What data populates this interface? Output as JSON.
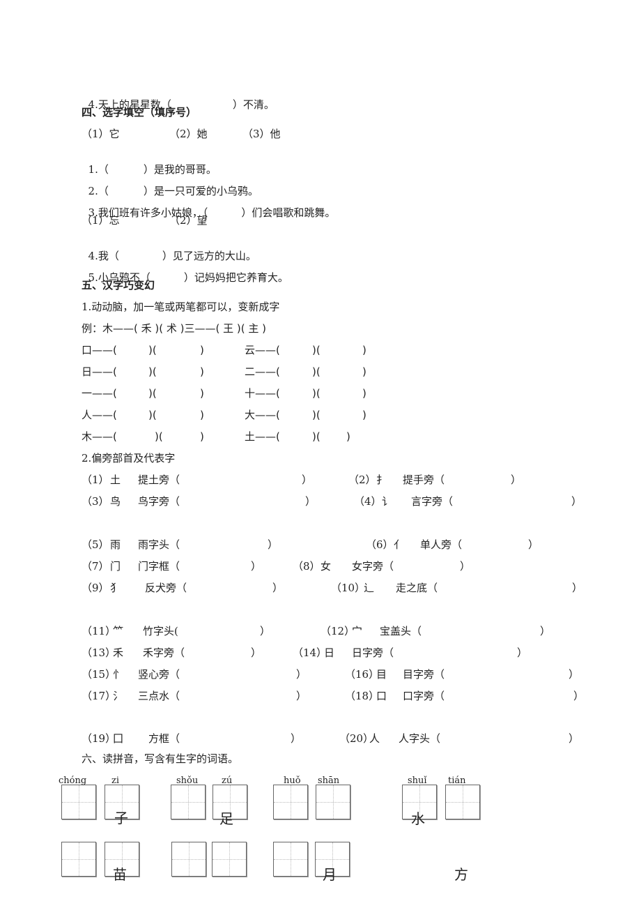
{
  "section3_tail": {
    "q4": {
      "pre": "4.天上的星星数（",
      "post": "）不清。"
    }
  },
  "section4": {
    "title": "四、选字填空（填序号）",
    "group1_options": [
      "（1）它",
      "（2）她",
      "（3）他"
    ],
    "q1": {
      "pre": "1.（",
      "post": "）是我的哥哥。"
    },
    "q2": {
      "pre": "2.（",
      "post": "）是一只可爱的小乌鸦。"
    },
    "q3": {
      "pre": "3.我们班有许多小姑娘，（",
      "post": "）们会唱歌和跳舞。"
    },
    "group2_options": [
      "（1）忘",
      "（2）望"
    ],
    "q4": {
      "pre": "4.我（",
      "post": "）见了远方的大山。"
    },
    "q5": {
      "pre": "5.小乌鸦不（",
      "post": "）记妈妈把它养育大。"
    }
  },
  "section5": {
    "title": "五、汉字巧变幻",
    "part1_title": "1.动动脑，加一笔或两笔都可以，变新成字",
    "example": "例：木——( 禾 )( 术 )三——( 王 )( 主 )",
    "rows": [
      {
        "left": "口——(",
        "right": "云——("
      },
      {
        "left": "日——(",
        "right": "二——("
      },
      {
        "left": "一——(",
        "right": "十——("
      },
      {
        "left": "人——(",
        "right": "大——("
      },
      {
        "left": "木——(",
        "right": "土——("
      }
    ],
    "paren_mid": ")(",
    "paren_close": ")",
    "part2_title": "2.偏旁部首及代表字",
    "radicals": [
      {
        "num": "（1）",
        "radical": "土",
        "name": "提土旁（"
      },
      {
        "num": "（2）",
        "radical": "扌",
        "name": "提手旁（"
      },
      {
        "num": "（3）",
        "radical": "鸟",
        "name": "鸟字旁（"
      },
      {
        "num": "（4）",
        "radical": "讠",
        "name": "言字旁（"
      },
      {
        "num": "（5）",
        "radical": "雨",
        "name": "雨字头（"
      },
      {
        "num": "（6）",
        "radical": "亻",
        "name": "单人旁（"
      },
      {
        "num": "（7）",
        "radical": "门",
        "name": "门字框（"
      },
      {
        "num": "（8）",
        "radical": "女",
        "name": "女字旁（"
      },
      {
        "num": "（9）",
        "radical": "犭",
        "name": "反犬旁（"
      },
      {
        "num": "（10）",
        "radical": "辶",
        "name": "走之底（"
      },
      {
        "num": "（11）",
        "radical": "⺮",
        "name": "竹字头("
      },
      {
        "num": "（12）",
        "radical": "宀",
        "name": "宝盖头（"
      },
      {
        "num": "（13）",
        "radical": "禾",
        "name": "禾字旁（"
      },
      {
        "num": "（14）",
        "radical": "日",
        "name": "日字旁（"
      },
      {
        "num": "（15）",
        "radical": "忄",
        "name": "竖心旁（"
      },
      {
        "num": "（16）",
        "radical": "目",
        "name": "目字旁（"
      },
      {
        "num": "（17）",
        "radical": "氵",
        "name": "三点水（"
      },
      {
        "num": "（18）",
        "radical": "口",
        "name": "口字旁（"
      },
      {
        "num": "（19）",
        "radical": "囗",
        "name": "方框（"
      },
      {
        "num": "（20）",
        "radical": "人",
        "name": "人字头（"
      }
    ],
    "close": "）"
  },
  "section6": {
    "title": "六、读拼音，写含有生字的词语。",
    "pinyin": [
      "chóng",
      "zi",
      "shǒu",
      "zú",
      "huǒ",
      "shān",
      "shuǐ",
      "tián"
    ],
    "row1_hints": [
      "子",
      "足",
      "水"
    ],
    "row2_hints": [
      "苗",
      "月",
      "方"
    ]
  }
}
